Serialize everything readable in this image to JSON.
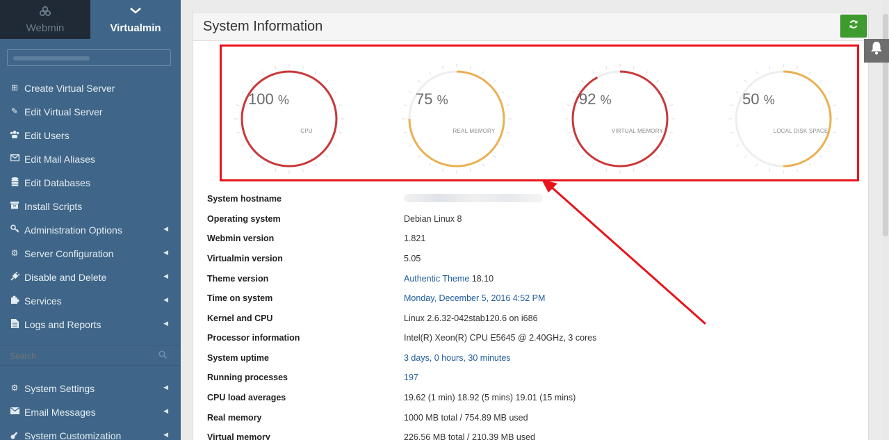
{
  "sidebar": {
    "tabs": [
      {
        "label": "Webmin",
        "icon": "webmin-logo-icon"
      },
      {
        "label": "Virtualmin",
        "icon": "chevron-down-icon"
      }
    ],
    "menu": [
      {
        "label": "Create Virtual Server",
        "icon": "plus-square-icon",
        "submenu": false
      },
      {
        "label": "Edit Virtual Server",
        "icon": "edit-icon",
        "submenu": false
      },
      {
        "label": "Edit Users",
        "icon": "users-icon",
        "submenu": false
      },
      {
        "label": "Edit Mail Aliases",
        "icon": "envelope-icon",
        "submenu": false
      },
      {
        "label": "Edit Databases",
        "icon": "database-icon",
        "submenu": false
      },
      {
        "label": "Install Scripts",
        "icon": "archive-icon",
        "submenu": false
      },
      {
        "label": "Administration Options",
        "icon": "key-icon",
        "submenu": true
      },
      {
        "label": "Server Configuration",
        "icon": "cogs-icon",
        "submenu": true
      },
      {
        "label": "Disable and Delete",
        "icon": "plug-icon",
        "submenu": true
      },
      {
        "label": "Services",
        "icon": "puzzle-icon",
        "submenu": true
      },
      {
        "label": "Logs and Reports",
        "icon": "file-icon",
        "submenu": true
      }
    ],
    "search_placeholder": "Search",
    "bottom_menu": [
      {
        "label": "System Settings",
        "icon": "gear-icon",
        "submenu": true
      },
      {
        "label": "Email Messages",
        "icon": "envelope-icon",
        "submenu": true
      },
      {
        "label": "System Customization",
        "icon": "wrench-icon",
        "submenu": true
      }
    ]
  },
  "panel": {
    "title": "System Information",
    "refresh_icon": "refresh-icon"
  },
  "gauges": [
    {
      "value": "100",
      "unit": "%",
      "label": "CPU",
      "percent": 100,
      "color": "#c9383a"
    },
    {
      "value": "75",
      "unit": "%",
      "label": "REAL MEMORY",
      "percent": 75,
      "color": "#ebb052"
    },
    {
      "value": "92",
      "unit": "%",
      "label": "VIRTUAL MEMORY",
      "percent": 92,
      "color": "#c9383a"
    },
    {
      "value": "50",
      "unit": "%",
      "label": "LOCAL DISK SPACE",
      "percent": 50,
      "color": "#ebb052"
    }
  ],
  "info": {
    "hostname_label": "System hostname",
    "os_label": "Operating system",
    "os_value": "Debian Linux 8",
    "webmin_label": "Webmin version",
    "webmin_value": "1.821",
    "virtualmin_label": "Virtualmin version",
    "virtualmin_value": "5.05",
    "theme_label": "Theme version",
    "theme_link": "Authentic Theme",
    "theme_value": "18.10",
    "time_label": "Time on system",
    "time_value": "Monday, December 5, 2016 4:52 PM",
    "kernel_label": "Kernel and CPU",
    "kernel_value": "Linux 2.6.32-042stab120.6 on i686",
    "processor_label": "Processor information",
    "processor_value": "Intel(R) Xeon(R) CPU E5645 @ 2.40GHz, 3 cores",
    "uptime_label": "System uptime",
    "uptime_value": "3 days, 0 hours, 30 minutes",
    "processes_label": "Running processes",
    "processes_value": "197",
    "load_label": "CPU load averages",
    "load_value": "19.62 (1 min) 18.92 (5 mins) 19.01 (15 mins)",
    "realmem_label": "Real memory",
    "realmem_value": "1000 MB total / 754.89 MB used",
    "virtmem_label": "Virtual memory",
    "virtmem_value": "226.56 MB total / 210.39 MB used"
  },
  "colors": {
    "sidebar": "#3f6688",
    "refresh_button": "#3f9b2e",
    "link": "#1f5c9e",
    "annotation": "#e8141b"
  }
}
